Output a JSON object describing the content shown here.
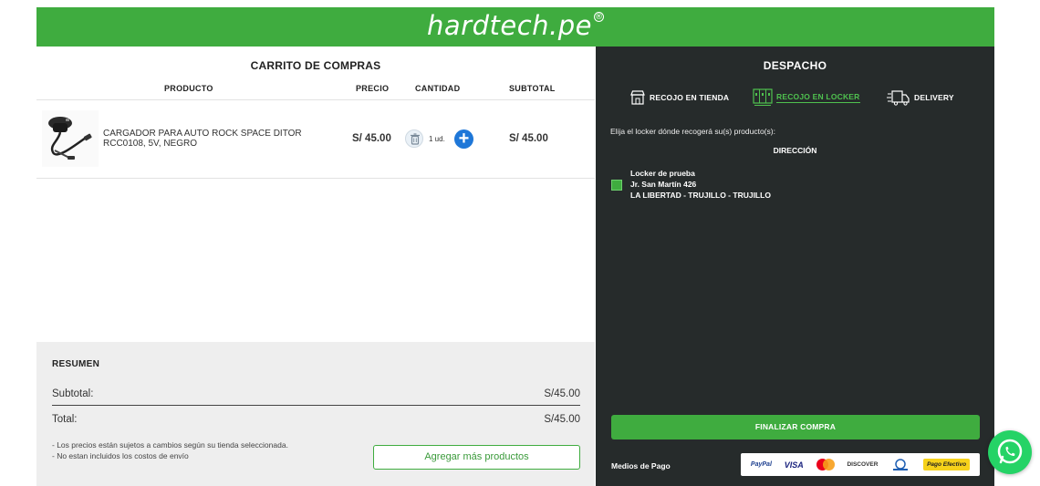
{
  "header": {
    "logo_text": "hardtech.pe",
    "logo_mark": "®",
    "brand_color": "#3fac3f"
  },
  "cart": {
    "title": "CARRITO DE COMPRAS",
    "columns": {
      "product": "PRODUCTO",
      "price": "PRECIO",
      "quantity": "CANTIDAD",
      "subtotal": "SUBTOTAL"
    },
    "items": [
      {
        "name": "CARGADOR PARA AUTO ROCK SPACE DITOR RCC0108, 5V, NEGRO",
        "price": "S/ 45.00",
        "quantity": "1 ud.",
        "subtotal": "S/ 45.00",
        "image_icon": "car-charger-icon"
      }
    ]
  },
  "summary": {
    "title": "RESUMEN",
    "subtotal_label": "Subtotal:",
    "subtotal_value": "S/45.00",
    "total_label": "Total:",
    "total_value": "S/45.00",
    "notes": [
      "- Los precios están sujetos a cambios según su tienda seleccionada.",
      "- No estan incluidos los costos de envío"
    ],
    "more_button": "Agregar más productos"
  },
  "despacho": {
    "title": "DESPACHO",
    "options": [
      {
        "label": "RECOJO EN TIENDA",
        "icon": "store-icon",
        "active": false
      },
      {
        "label": "RECOJO EN LOCKER",
        "icon": "locker-icon",
        "active": true
      },
      {
        "label": "DELIVERY",
        "icon": "truck-icon",
        "active": false
      }
    ],
    "choose_text": "Elija el locker dónde recogerá su(s) producto(s):",
    "address_header": "DIRECCIÓN",
    "locker": {
      "name": "Locker de prueba",
      "street": "Jr. San Martín 426",
      "region": "LA LIBERTAD - TRUJILLO - TRUJILLO",
      "selected": true
    },
    "finish_button": "FINALIZAR COMPRA",
    "payment_label": "Medios de Pago",
    "payment_methods": [
      "PayPal",
      "VISA",
      "DISCOVER",
      "Pago Efectivo"
    ]
  },
  "colors": {
    "panel_dark": "#262b2b",
    "accent": "#3fac3f",
    "plus_blue": "#1e77d8",
    "whatsapp": "#25d366"
  }
}
